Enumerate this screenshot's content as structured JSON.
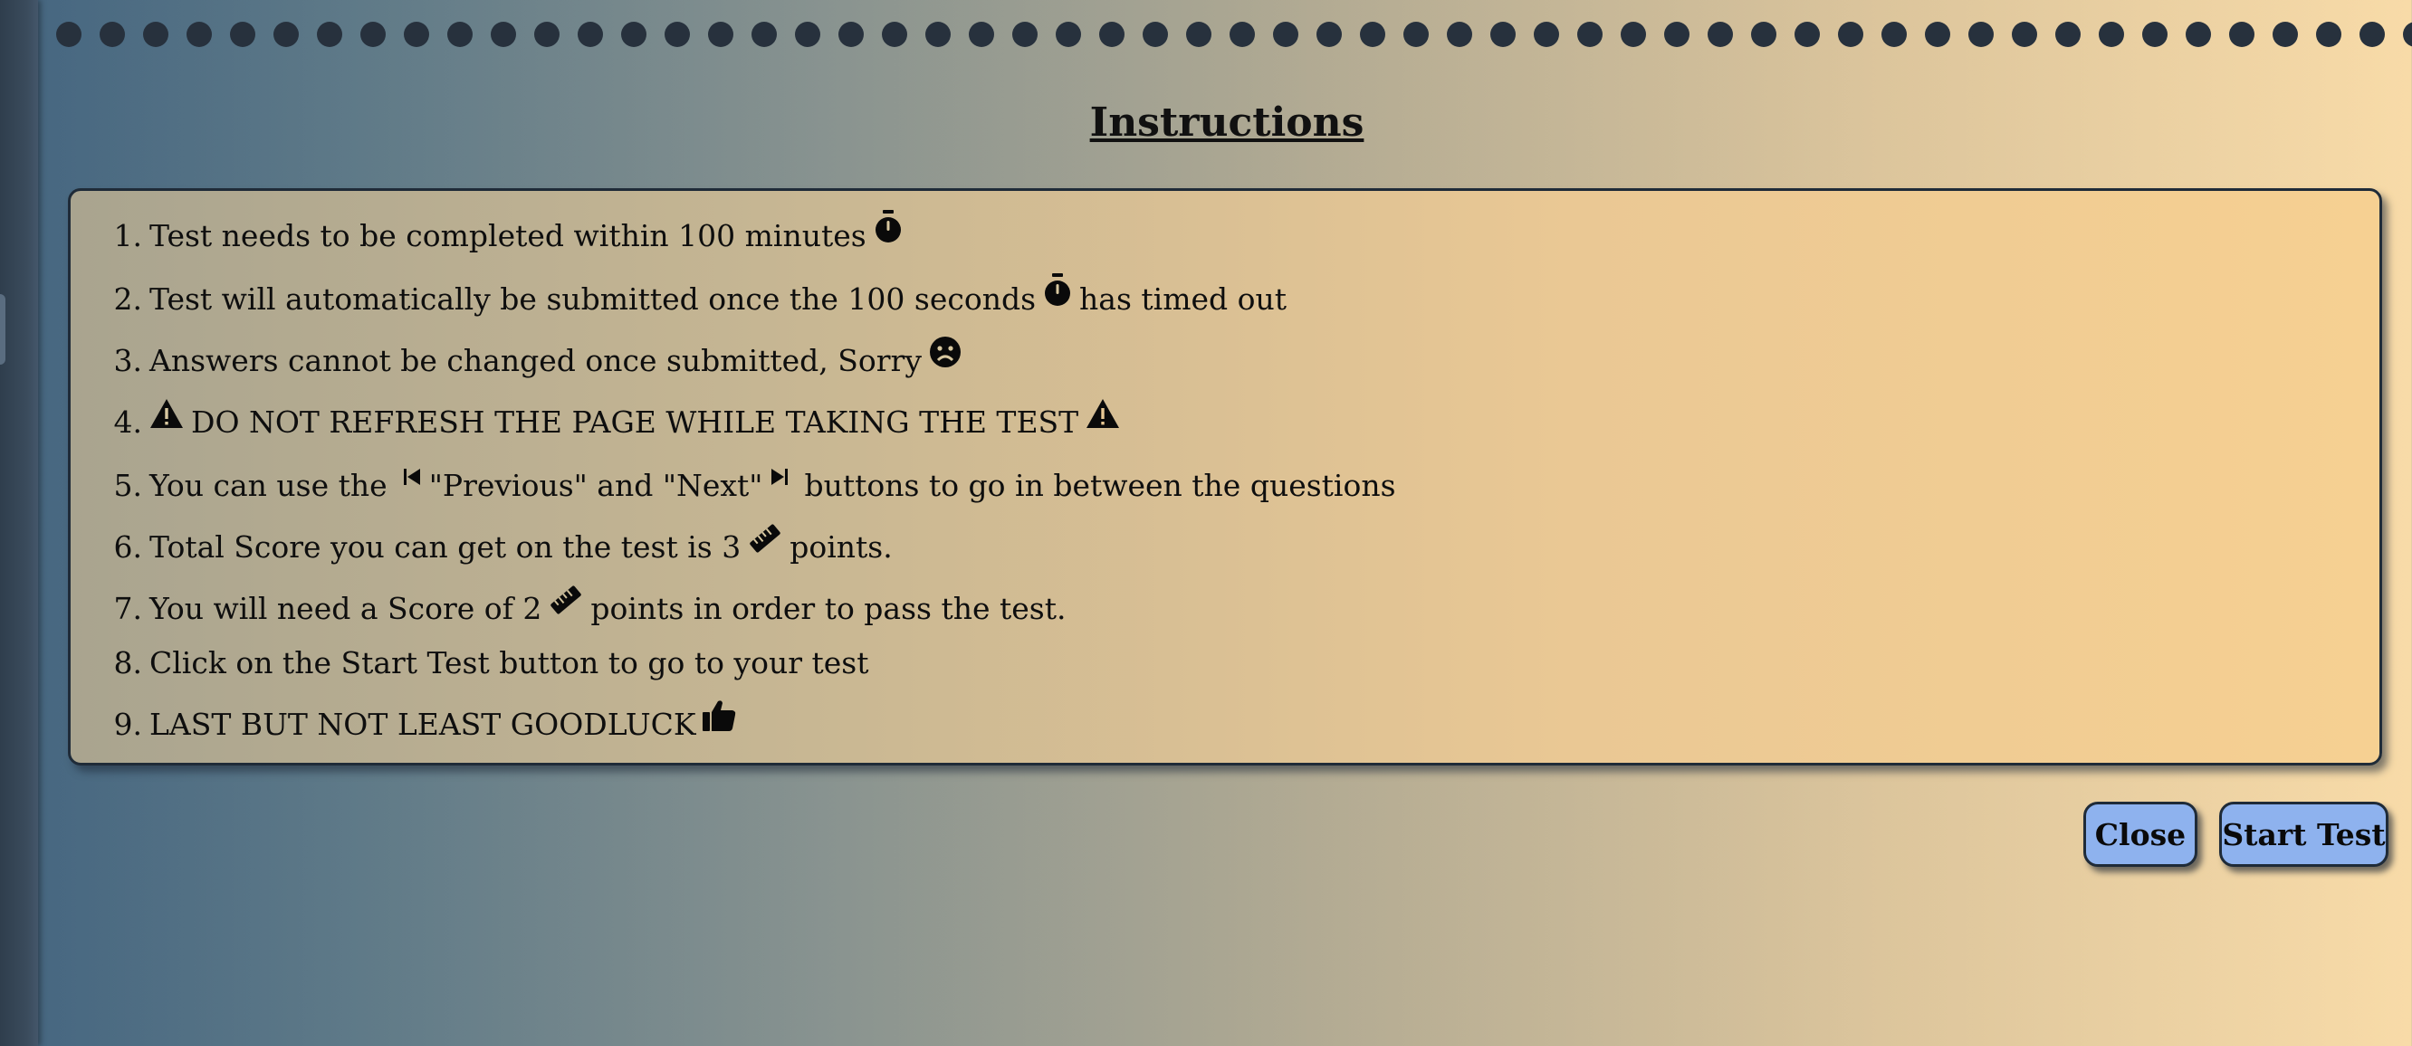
{
  "title": "Instructions",
  "instructions": [
    {
      "num": "1.",
      "a": "Test needs to be completed within 100 minutes",
      "icon1": "stopwatch-icon"
    },
    {
      "num": "2.",
      "a": "Test will automatically be submitted once the 100 seconds",
      "icon1": "stopwatch-icon",
      "b": "has timed out"
    },
    {
      "num": "3.",
      "a": "Answers cannot be changed once submitted, Sorry",
      "icon1": "sad-face-icon"
    },
    {
      "num": "4.",
      "icon0": "warning-icon",
      "a": "DO NOT REFRESH THE PAGE WHILE TAKING THE TEST",
      "icon1": "warning-icon"
    },
    {
      "num": "5.",
      "a": "You can use the",
      "icon1": "skip-previous-icon",
      "b": "\"Previous\" and \"Next\"",
      "icon2": "skip-next-icon",
      "c": "buttons to go in between the questions"
    },
    {
      "num": "6.",
      "a": "Total Score you can get on the test is 3",
      "icon1": "ruler-icon",
      "b": "points."
    },
    {
      "num": "7.",
      "a": "You will need a Score of 2",
      "icon1": "ruler-icon",
      "b": "points in order to pass the test."
    },
    {
      "num": "8.",
      "a": "Click on the Start Test button to go to your test"
    },
    {
      "num": "9.",
      "a": "LAST BUT NOT LEAST GOODLUCK",
      "icon1": "thumbs-up-icon"
    }
  ],
  "buttons": {
    "close": "Close",
    "start": "Start Test"
  },
  "colors": {
    "button_bg": "#8eb2ee",
    "panel_border": "#1f2b38",
    "dots": "#27313d"
  }
}
